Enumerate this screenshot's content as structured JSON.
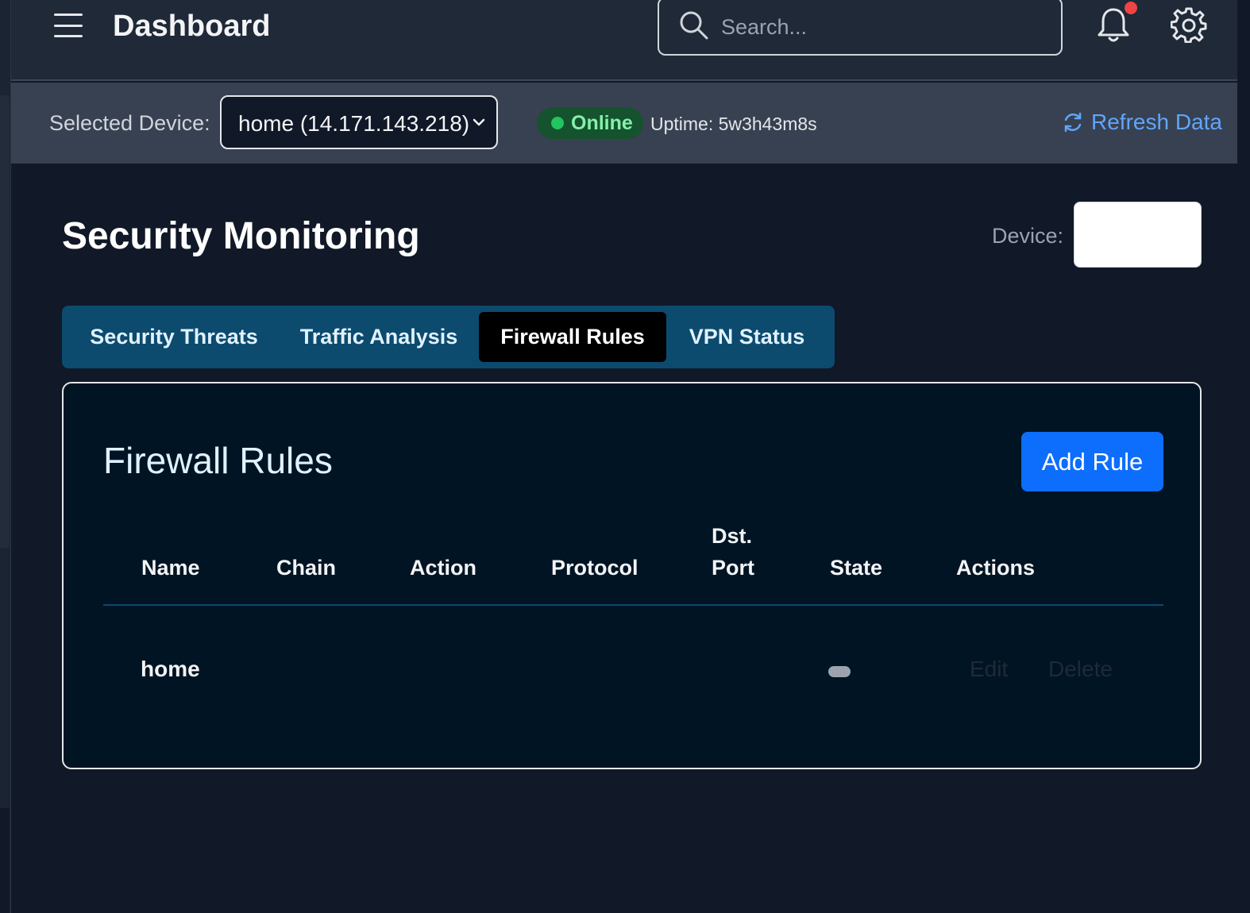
{
  "header": {
    "title": "Dashboard",
    "search_placeholder": "Search...",
    "notification_badge_color": "#ef4444"
  },
  "device_bar": {
    "selected_device_label": "Selected Device:",
    "selected_device_value": "home (14.171.143.218)",
    "status": "Online",
    "uptime": "Uptime: 5w3h43m8s",
    "refresh_label": "Refresh Data"
  },
  "page": {
    "title": "Security Monitoring",
    "device_label": "Device:"
  },
  "tabs": [
    {
      "label": "Security Threats",
      "active": false
    },
    {
      "label": "Traffic Analysis",
      "active": false
    },
    {
      "label": "Firewall Rules",
      "active": true
    },
    {
      "label": "VPN Status",
      "active": false
    }
  ],
  "firewall": {
    "title": "Firewall Rules",
    "add_button_label": "Add Rule",
    "columns": [
      "Name",
      "Chain",
      "Action",
      "Protocol",
      "Dst.",
      "Port",
      "State",
      "Actions"
    ],
    "rows": [
      {
        "name": "home",
        "chain": "",
        "action": "",
        "protocol": "",
        "dst_port": "",
        "edit_label": "Edit",
        "delete_label": "Delete"
      }
    ]
  },
  "colors": {
    "accent": "#0d6efd",
    "link": "#60a5fa",
    "online": "#22c55e",
    "tabs_bg": "#0c4a6e"
  },
  "icons": [
    "hamburger-icon",
    "search-icon",
    "bell-icon",
    "gear-icon",
    "chevron-down-icon",
    "refresh-icon"
  ]
}
